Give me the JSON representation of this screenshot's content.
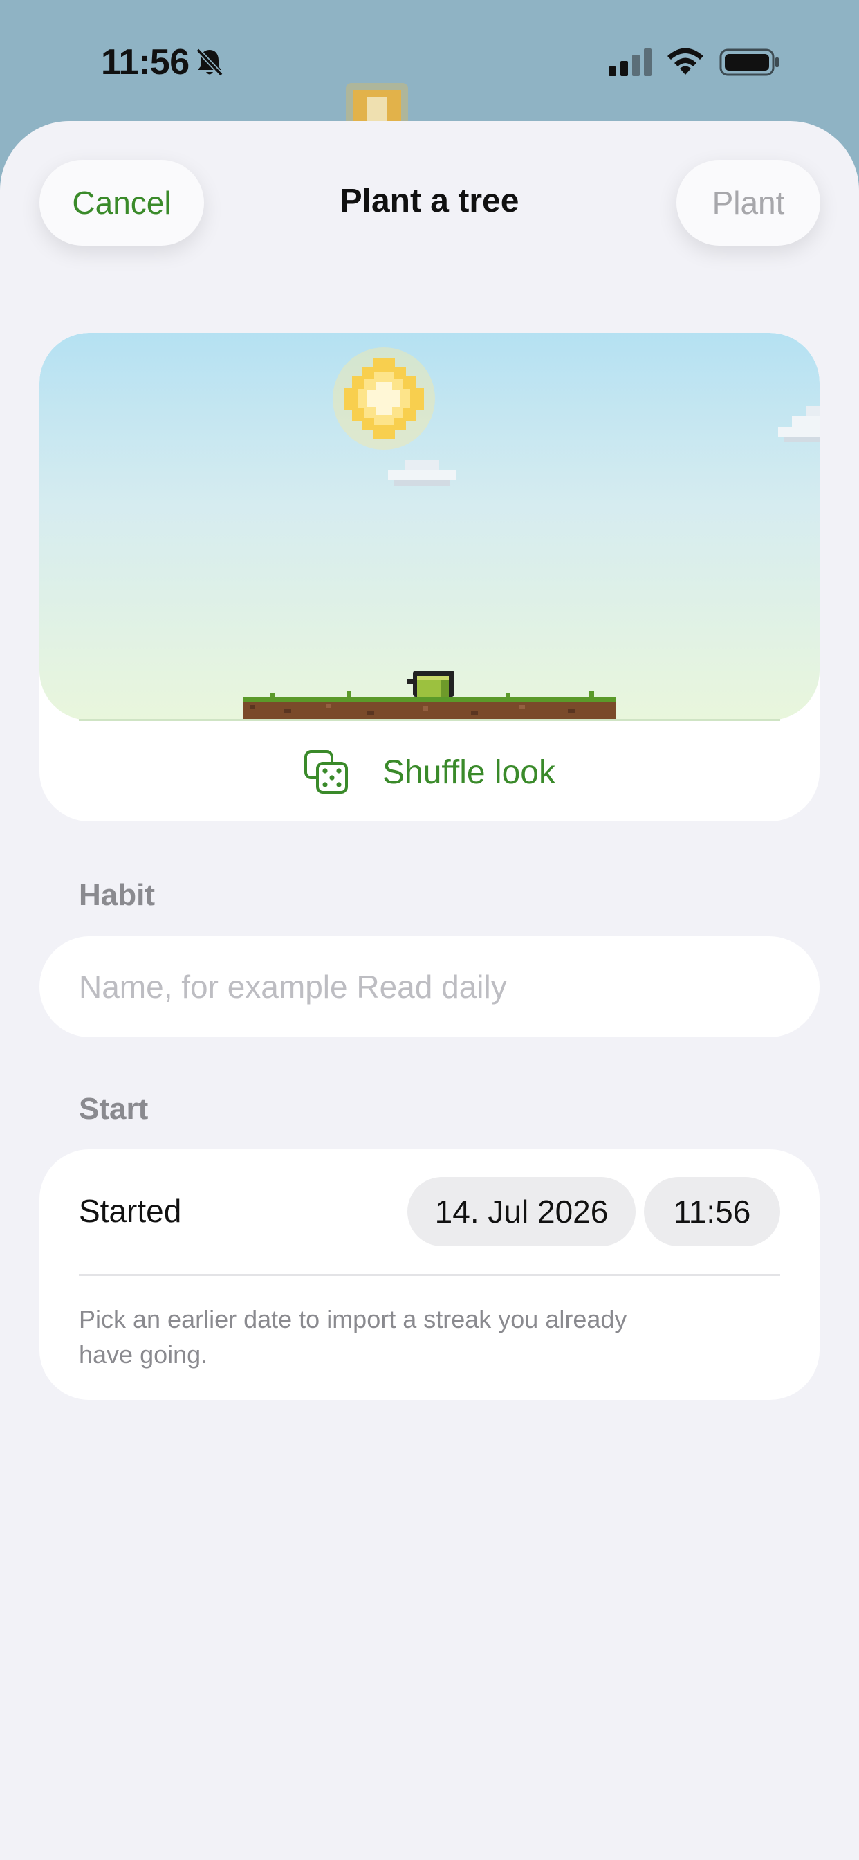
{
  "status_bar": {
    "time": "11:56",
    "icons": [
      "bell-slash-icon",
      "cellular-signal-icon",
      "wifi-icon",
      "battery-icon"
    ]
  },
  "sheet": {
    "title": "Plant a tree",
    "cancel_label": "Cancel",
    "plant_label": "Plant"
  },
  "preview": {
    "shuffle_label": "Shuffle look",
    "shuffle_icon": "dice-icon"
  },
  "habit": {
    "section_label": "Habit",
    "input_value": "",
    "input_placeholder": "Name, for example Read daily"
  },
  "start": {
    "section_label": "Start",
    "row_label": "Started",
    "date_value": "14. Jul 2026",
    "time_value": "11:56",
    "hint": "Pick an earlier date to import a streak you already have going."
  },
  "colors": {
    "accent": "#3a8a2a",
    "disabled": "#a7a7ab",
    "sheet_background": "#f2f2f7",
    "backdrop": "#8fb3c4",
    "section_label": "#8a8a8f"
  }
}
